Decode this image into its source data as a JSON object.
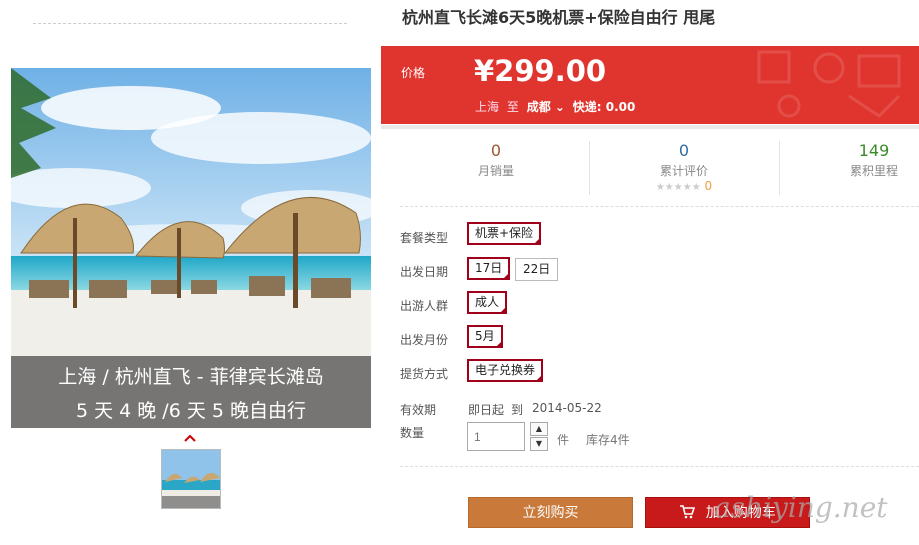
{
  "gallery": {
    "caption_line1": "上海 / 杭州直飞 - 菲律宾长滩岛",
    "caption_line2": "5 天 4 晚 /6 天 5 晚自由行",
    "arrow_icon": "chevron-up-icon"
  },
  "product": {
    "title": "杭州直飞长滩6天5晚机票+保险自由行 甩尾"
  },
  "price": {
    "label": "价格",
    "value": "¥299.00",
    "from_city": "上海",
    "to_word": "至",
    "to_city": "成都",
    "shipping": "快递: 0.00"
  },
  "stats": {
    "monthly_sales_value": "0",
    "monthly_sales_label": "月销量",
    "reviews_value": "0",
    "reviews_label": "累计评价",
    "rating_count": "0",
    "mileage_value": "149",
    "mileage_label": "累积里程"
  },
  "options": {
    "package_label": "套餐类型",
    "package_value": "机票+保险",
    "date_label": "出发日期",
    "date_options": [
      "17日",
      "22日"
    ],
    "people_label": "出游人群",
    "people_value": "成人",
    "month_label": "出发月份",
    "month_value": "5月",
    "delivery_label": "提货方式",
    "delivery_value": "电子兑换券"
  },
  "validity": {
    "label": "有效期",
    "from": "即日起",
    "to_word": "到",
    "date": "2014-05-22"
  },
  "quantity": {
    "label": "数量",
    "value": "1",
    "unit": "件",
    "stock": "库存4件"
  },
  "buttons": {
    "buy_now": "立刻购买",
    "add_to_cart": "加入购物车"
  },
  "watermark": "ashiying.net",
  "colors": {
    "price_bg": "#e0352f",
    "buy_button": "#c97a3b",
    "cart_button": "#c81a1a",
    "selected_border": "#a0001a"
  }
}
